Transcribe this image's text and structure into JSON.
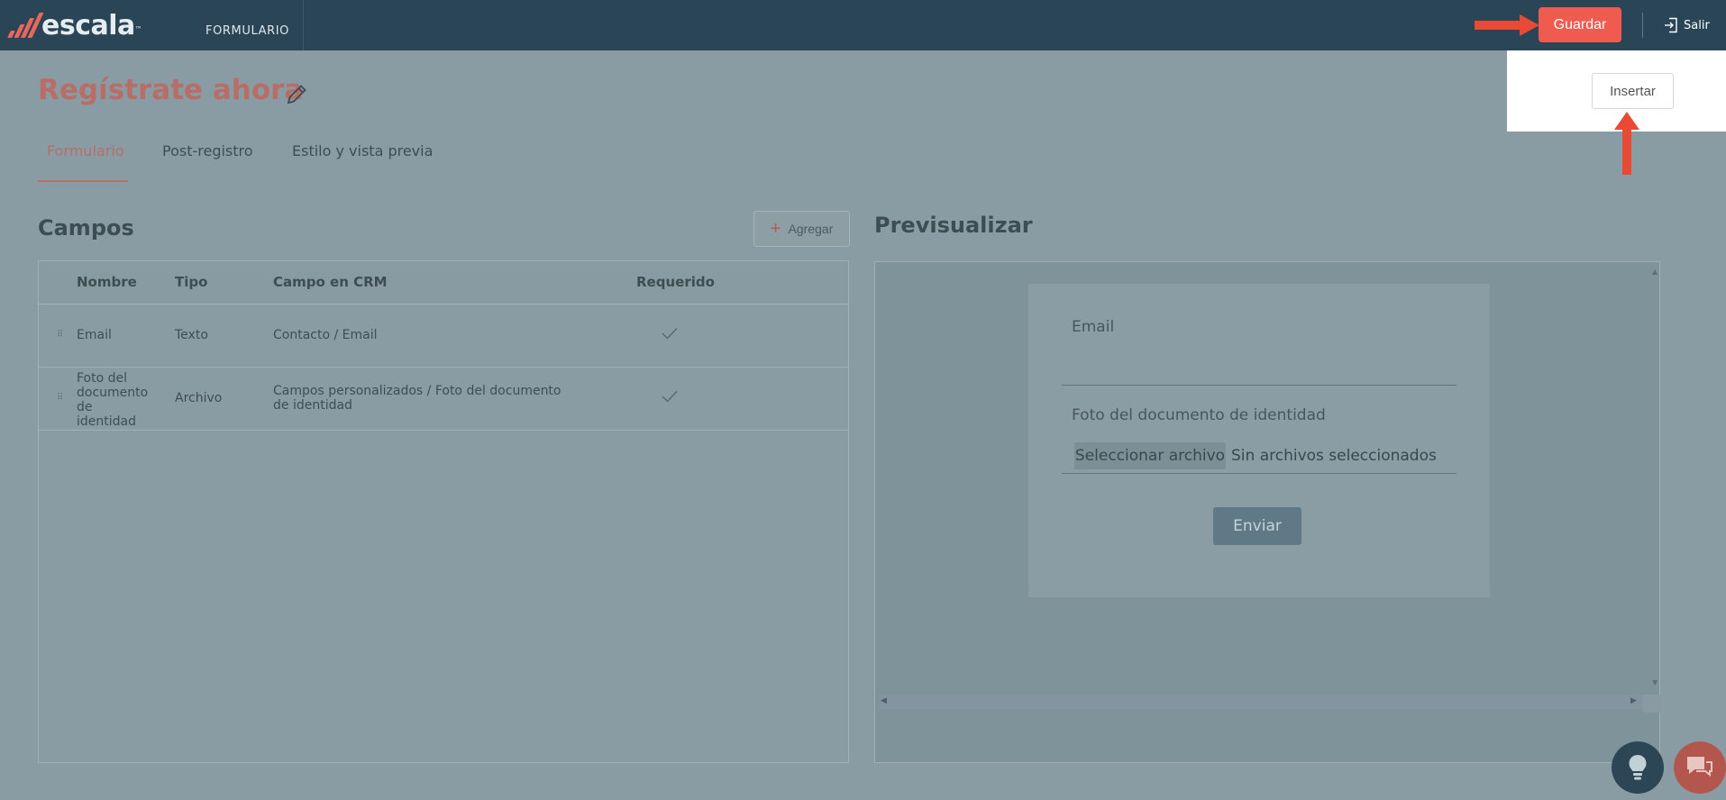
{
  "app": {
    "logo_text": "escala",
    "logo_tm": "™",
    "nav_section": "FORMULARIO",
    "save_label": "Guardar",
    "exit_label": "Salir"
  },
  "page": {
    "title": "Regístrate ahora",
    "tabs": [
      {
        "label": "Formulario",
        "active": true
      },
      {
        "label": "Post-registro",
        "active": false
      },
      {
        "label": "Estilo y vista previa",
        "active": false
      }
    ]
  },
  "fields": {
    "title": "Campos",
    "add_label": "Agregar",
    "columns": [
      "Nombre",
      "Tipo",
      "Campo en CRM",
      "Requerido"
    ],
    "rows": [
      {
        "name": "Email",
        "type": "Texto",
        "crm": "Contacto / Email",
        "required": true
      },
      {
        "name": "Foto del documento de identidad",
        "type": "Archivo",
        "crm": "Campos personalizados / Foto del documento de identidad",
        "required": true
      }
    ]
  },
  "preview": {
    "title": "Previsualizar",
    "email_label": "Email",
    "file_label": "Foto del documento de identidad",
    "file_button": "Seleccionar archivo",
    "file_status": "Sin archivos seleccionados",
    "submit_label": "Enviar"
  },
  "insert": {
    "label": "Insertar"
  },
  "colors": {
    "accent": "#ef5b4f",
    "topbar": "#2a4556",
    "overlay": "#8a9ca3",
    "title": "#b86e67"
  }
}
